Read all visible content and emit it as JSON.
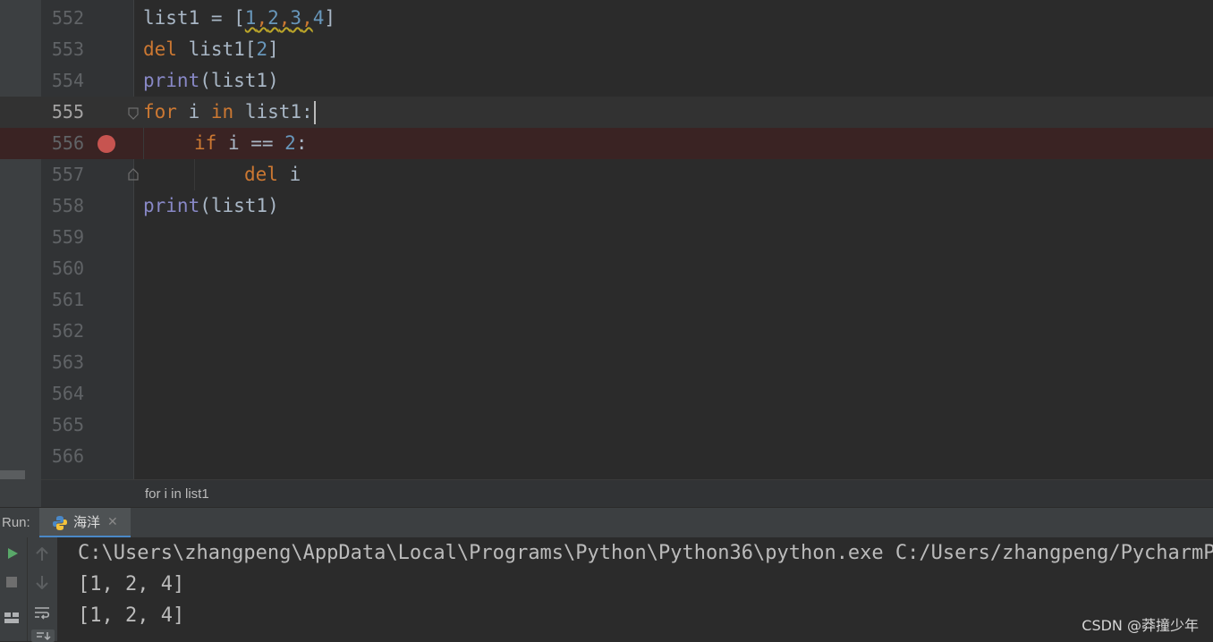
{
  "editor": {
    "lines": [
      {
        "num": "552"
      },
      {
        "num": "553",
        "t0": "del",
        "t1": " list1[",
        "t2": "2",
        "t3": "]"
      },
      {
        "num": "554",
        "t0": "print",
        "t1": "(list1)"
      },
      {
        "num": "555",
        "t0": "for",
        "t1": " i ",
        "t2": "in",
        "t3": " list1:"
      },
      {
        "num": "556",
        "t0": "if",
        "t1": " i == ",
        "t2": "2",
        "t3": ":"
      },
      {
        "num": "557",
        "t0": "del",
        "t1": " i"
      },
      {
        "num": "558",
        "t0": "print",
        "t1": "(list1)"
      },
      {
        "num": "559"
      },
      {
        "num": "560"
      },
      {
        "num": "561"
      },
      {
        "num": "562"
      },
      {
        "num": "563"
      },
      {
        "num": "564"
      },
      {
        "num": "565"
      },
      {
        "num": "566"
      }
    ],
    "line552": {
      "a": "list1 = [",
      "n1": "1",
      "n2": "2",
      "n3": "3",
      "n4": "4",
      "sep": ",",
      "close": "]"
    },
    "current_line": "555",
    "breakpoint_line": "556"
  },
  "breadcrumb": "for i in list1",
  "run": {
    "label": "Run:",
    "tab_label": "海洋",
    "tab_close": "✕",
    "console": [
      "C:\\Users\\zhangpeng\\AppData\\Local\\Programs\\Python\\Python36\\python.exe C:/Users/zhangpeng/PycharmProjects/",
      "[1, 2, 4]",
      "[1, 2, 4]"
    ]
  },
  "watermark": "CSDN @莽撞少年",
  "icons": [
    "rerun-icon",
    "stop-icon",
    "layout-icon",
    "scroll-up-icon",
    "scroll-down-icon",
    "soft-wrap-icon",
    "scroll-to-end-icon",
    "python-icon",
    "breakpoint-icon",
    "fold-icon"
  ],
  "colors": {
    "keyword": "#cc7832",
    "number": "#6897bb",
    "builtin": "#8888c6",
    "text": "#a9b7c6",
    "breakpoint": "#c75450",
    "background": "#2b2b2b"
  }
}
